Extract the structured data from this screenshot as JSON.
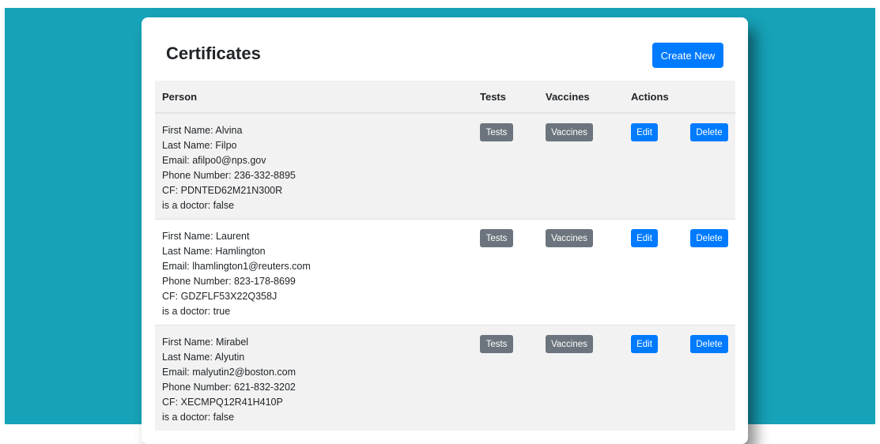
{
  "page": {
    "title": "Certificates",
    "create_label": "Create New"
  },
  "table": {
    "headers": {
      "person": "Person",
      "tests": "Tests",
      "vaccines": "Vaccines",
      "actions": "Actions"
    },
    "rows": [
      {
        "first_name": "First Name: Alvina",
        "last_name": "Last Name: Filpo",
        "email": "Email: afilpo0@nps.gov",
        "phone": "Phone Number: 236-332-8895",
        "cf": "CF: PDNTED62M21N300R",
        "doctor": "is a doctor: false",
        "tests_btn": "Tests",
        "vaccines_btn": "Vaccines",
        "edit_btn": "Edit",
        "delete_btn": "Delete"
      },
      {
        "first_name": "First Name: Laurent",
        "last_name": "Last Name: Hamlington",
        "email": "Email: lhamlington1@reuters.com",
        "phone": "Phone Number: 823-178-8699",
        "cf": "CF: GDZFLF53X22Q358J",
        "doctor": "is a doctor: true",
        "tests_btn": "Tests",
        "vaccines_btn": "Vaccines",
        "edit_btn": "Edit",
        "delete_btn": "Delete"
      },
      {
        "first_name": "First Name: Mirabel",
        "last_name": "Last Name: Alyutin",
        "email": "Email: malyutin2@boston.com",
        "phone": "Phone Number: 621-832-3202",
        "cf": "CF: XECMPQ12R41H410P",
        "doctor": "is a doctor: false",
        "tests_btn": "Tests",
        "vaccines_btn": "Vaccines",
        "edit_btn": "Edit",
        "delete_btn": "Delete"
      }
    ]
  },
  "colors": {
    "backdrop": "#16a2b8",
    "primary": "#007bff",
    "secondary": "#6c757d",
    "stripe": "#f2f2f2"
  }
}
